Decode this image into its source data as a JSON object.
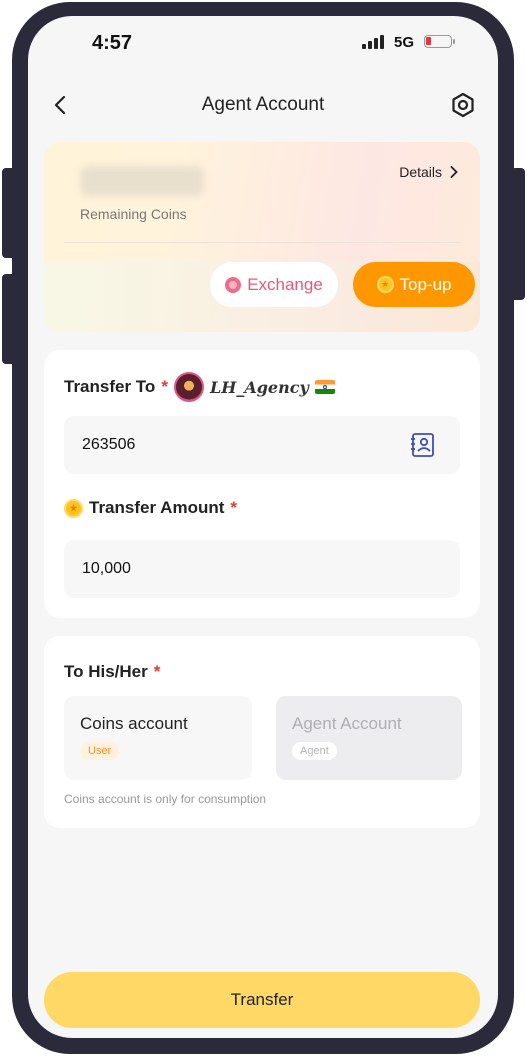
{
  "status_bar": {
    "time": "4:57",
    "network": "5G"
  },
  "header": {
    "title": "Agent Account"
  },
  "coins_card": {
    "remaining_label": "Remaining Coins",
    "details_label": "Details",
    "exchange_label": "Exchange",
    "topup_label": "Top-up"
  },
  "transfer": {
    "to_label": "Transfer To",
    "agency_name": "LH_Agency",
    "recipient_id": "263506",
    "amount_label": "Transfer Amount",
    "amount_value": "10,000"
  },
  "destination": {
    "label": "To His/Her",
    "options": [
      {
        "title": "Coins account",
        "badge": "User",
        "selected": true
      },
      {
        "title": "Agent Account",
        "badge": "Agent",
        "selected": false
      }
    ],
    "hint": "Coins account is only for consumption"
  },
  "required_mark": "*",
  "footer": {
    "transfer_button": "Transfer"
  },
  "colors": {
    "accent": "#ff9800",
    "primary_button": "#ffd866",
    "required": "#e53935",
    "exchange": "#e85a73"
  }
}
